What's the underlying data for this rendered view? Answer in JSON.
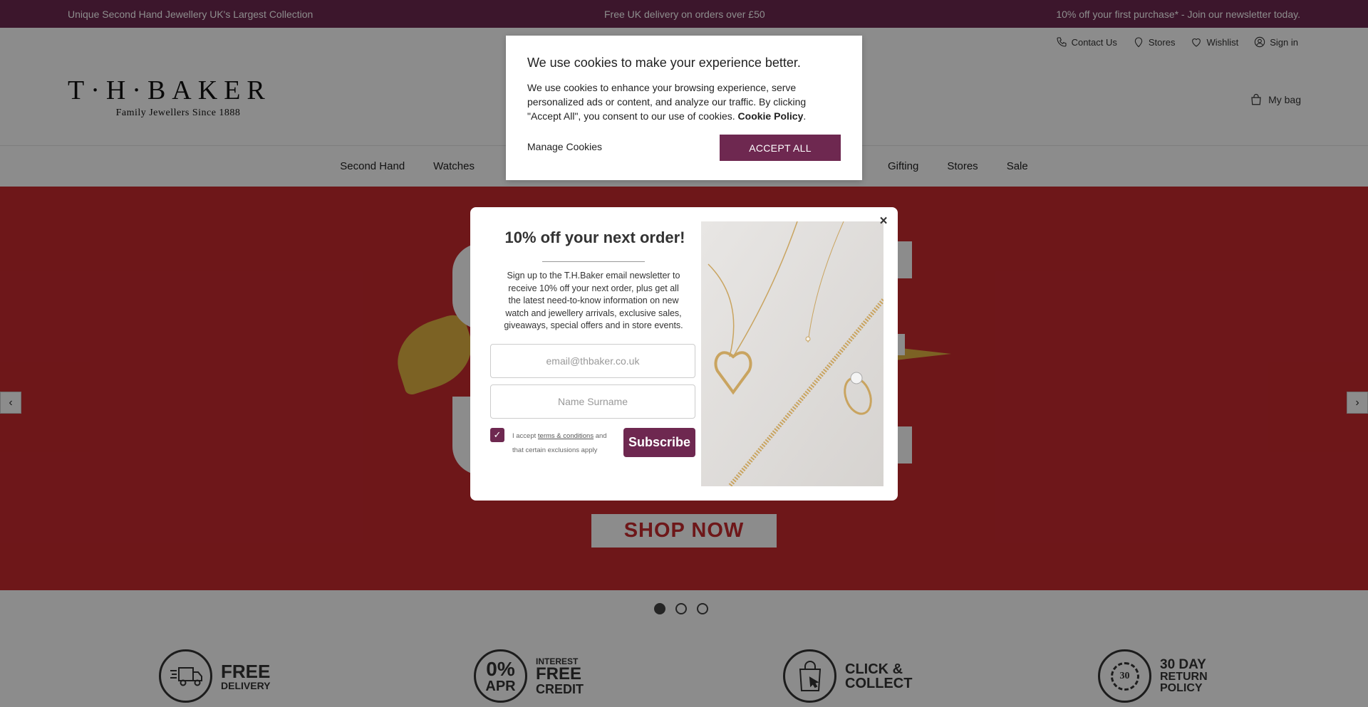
{
  "announcement": {
    "left": "Unique Second Hand Jewellery UK's Largest Collection",
    "center": "Free UK delivery on orders over £50",
    "right": "10% off your first purchase* - Join our newsletter today."
  },
  "header": {
    "utility": [
      {
        "label": "Contact Us",
        "icon": "phone-icon"
      },
      {
        "label": "Stores",
        "icon": "location-pin-icon"
      },
      {
        "label": "Wishlist",
        "icon": "heart-icon"
      },
      {
        "label": "Sign in",
        "icon": "user-icon"
      }
    ],
    "logo_main": "T·H·BAKER",
    "logo_sub": "Family Jewellers Since 1888",
    "bag_label": "My bag"
  },
  "nav": {
    "items": [
      "Second Hand",
      "Watches",
      "Gifting",
      "Stores",
      "Sale"
    ]
  },
  "hero": {
    "cta": "SHOP NOW",
    "slide_count": 3,
    "active_slide": 1
  },
  "usps": [
    {
      "line1": "FREE",
      "line2": "DELIVERY"
    },
    {
      "badge": "0%",
      "badge_sub": "APR",
      "line0": "INTEREST",
      "line1": "FREE",
      "line2": "CREDIT"
    },
    {
      "line1": "CLICK &",
      "line2": "COLLECT"
    },
    {
      "badge": "30",
      "line1": "30 DAY",
      "line2": "RETURN",
      "line3": "POLICY"
    }
  ],
  "newsletter": {
    "title": "10% off your next order!",
    "body": "Sign up to the T.H.Baker email newsletter to receive 10% off your next order, plus get all the latest need-to-know information on new watch and jewellery arrivals, exclusive sales, giveaways, special offers and in store events.",
    "email_placeholder": "email@thbaker.co.uk",
    "name_placeholder": "Name Surname",
    "terms_prefix": "I accept ",
    "terms_link": "terms & conditions",
    "terms_suffix": " and that certain exclusions apply",
    "subscribe_label": "Subscribe",
    "close_label": "×"
  },
  "cookie": {
    "title": "We use cookies to make your experience better.",
    "body": "We use cookies to enhance your browsing experience, serve personalized ads or content, and analyze our traffic. By clicking \"Accept All\", you consent to our use of cookies. ",
    "policy_link": "Cookie Policy",
    "policy_suffix": ".",
    "manage_label": "Manage Cookies",
    "accept_label": "ACCEPT ALL"
  },
  "colors": {
    "brand": "#6e2850",
    "hero_red": "#c92a2f",
    "ribbon_gold": "#e2b243"
  }
}
